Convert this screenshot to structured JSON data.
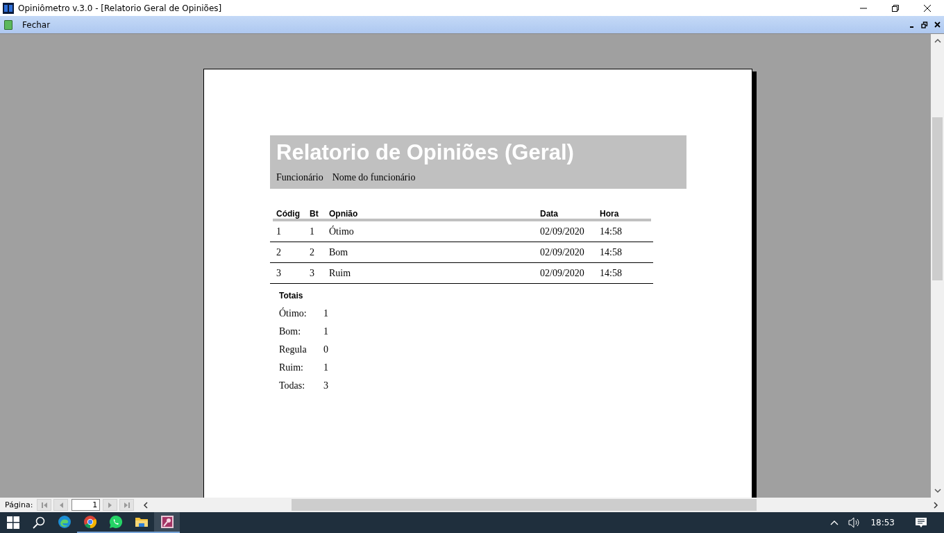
{
  "window": {
    "title": "Opiniômetro v.3.0 - [Relatorio Geral de Opiniões]"
  },
  "menu": {
    "items": [
      {
        "label": "Fechar"
      }
    ]
  },
  "report": {
    "title": "Relatorio de Opiniões (Geral)",
    "employee_label": "Funcionário",
    "employee_name": "Nome do funcionário",
    "columns": [
      "Códig",
      "Bt",
      "Opnião",
      "Data",
      "Hora"
    ],
    "rows": [
      [
        "1",
        "1",
        "Ótimo",
        "02/09/2020",
        "14:58"
      ],
      [
        "2",
        "2",
        "Bom",
        "02/09/2020",
        "14:58"
      ],
      [
        "3",
        "3",
        "Ruim",
        "02/09/2020",
        "14:58"
      ]
    ],
    "totals_heading": "Totais",
    "totals": [
      {
        "label": "Ótimo:",
        "value": "1"
      },
      {
        "label": "Bom:",
        "value": "1"
      },
      {
        "label": "Regula",
        "value": "0"
      },
      {
        "label": "Ruim:",
        "value": "1"
      },
      {
        "label": "Todas:",
        "value": "3"
      }
    ]
  },
  "status_bar": {
    "page_label": "Página:",
    "page_value": "1"
  },
  "taskbar": {
    "apps": [
      {
        "kind": "edge",
        "running": false,
        "selected": false
      },
      {
        "kind": "chrome",
        "running": true,
        "selected": false
      },
      {
        "kind": "whatsapp",
        "running": true,
        "selected": false
      },
      {
        "kind": "folder",
        "running": true,
        "selected": false
      },
      {
        "kind": "access",
        "running": true,
        "selected": true
      }
    ],
    "clock": "18:53"
  }
}
